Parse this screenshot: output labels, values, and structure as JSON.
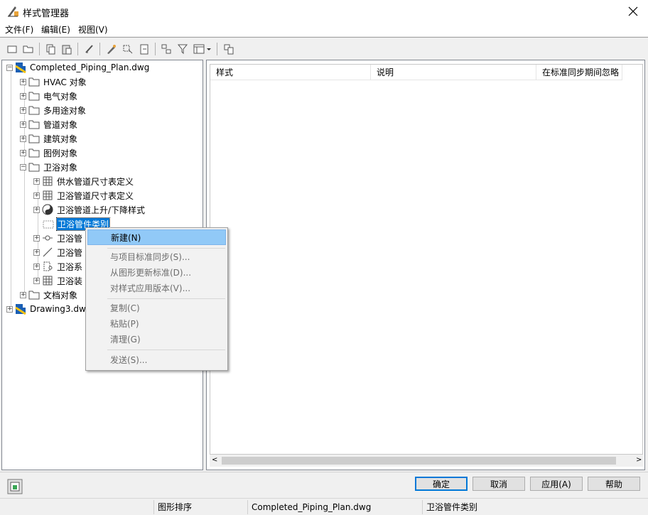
{
  "window": {
    "title": "样式管理器"
  },
  "menu": [
    {
      "label": "文件(F)"
    },
    {
      "label": "编辑(E)"
    },
    {
      "label": "视图(V)"
    }
  ],
  "toolbar": {
    "icons": [
      "new-icon",
      "open-icon",
      "copy-icon",
      "paste-icon",
      "purge-icon",
      "edit-style-icon",
      "sync-icon",
      "import-icon",
      "sort-icon",
      "filter-icon",
      "view-menu-icon",
      "help-icon"
    ]
  },
  "tree": {
    "nodes": [
      {
        "label": "Completed_Piping_Plan.dwg",
        "icon": "drawing-icon"
      },
      {
        "label": "HVAC 对象",
        "icon": "folder-icon"
      },
      {
        "label": "电气对象",
        "icon": "folder-icon"
      },
      {
        "label": "多用途对象",
        "icon": "folder-icon"
      },
      {
        "label": "管道对象",
        "icon": "folder-icon"
      },
      {
        "label": "建筑对象",
        "icon": "folder-icon"
      },
      {
        "label": "图例对象",
        "icon": "folder-icon"
      },
      {
        "label": "卫浴对象",
        "icon": "folder-open-icon"
      },
      {
        "label": "供水管道尺寸表定义",
        "icon": "table-icon"
      },
      {
        "label": "卫浴管道尺寸表定义",
        "icon": "table-icon"
      },
      {
        "label": "卫浴管道上升/下降样式",
        "icon": "rise-drop-icon"
      },
      {
        "label": "卫浴管件类别",
        "icon": "fitting-category-icon"
      },
      {
        "label": "卫浴管",
        "icon": "fitting-icon"
      },
      {
        "label": "卫浴管",
        "icon": "line-icon"
      },
      {
        "label": "卫浴系",
        "icon": "system-icon"
      },
      {
        "label": "卫浴装",
        "icon": "table-icon"
      },
      {
        "label": "文档对象",
        "icon": "folder-icon"
      },
      {
        "label": "Drawing3.dw",
        "icon": "drawing-icon"
      }
    ]
  },
  "list": {
    "columns": [
      "样式",
      "说明",
      "在标准同步期间忽略"
    ]
  },
  "context_menu": {
    "items": [
      {
        "label": "新建(N)",
        "active": true
      },
      {
        "label": "与项目标准同步(S)..."
      },
      {
        "label": "从图形更新标准(D)..."
      },
      {
        "label": "对样式应用版本(V)..."
      },
      {
        "label": "复制(C)"
      },
      {
        "label": "粘贴(P)"
      },
      {
        "label": "清理(G)"
      },
      {
        "label": "发送(S)..."
      }
    ]
  },
  "buttons": {
    "ok": "确定",
    "cancel": "取消",
    "apply": "应用(A)",
    "help": "帮助"
  },
  "status": {
    "sort": "图形排序",
    "file": "Completed_Piping_Plan.dwg",
    "selection": "卫浴管件类别"
  },
  "colors": {
    "selection": "#0078d7",
    "menu_highlight": "#91c9f7"
  }
}
